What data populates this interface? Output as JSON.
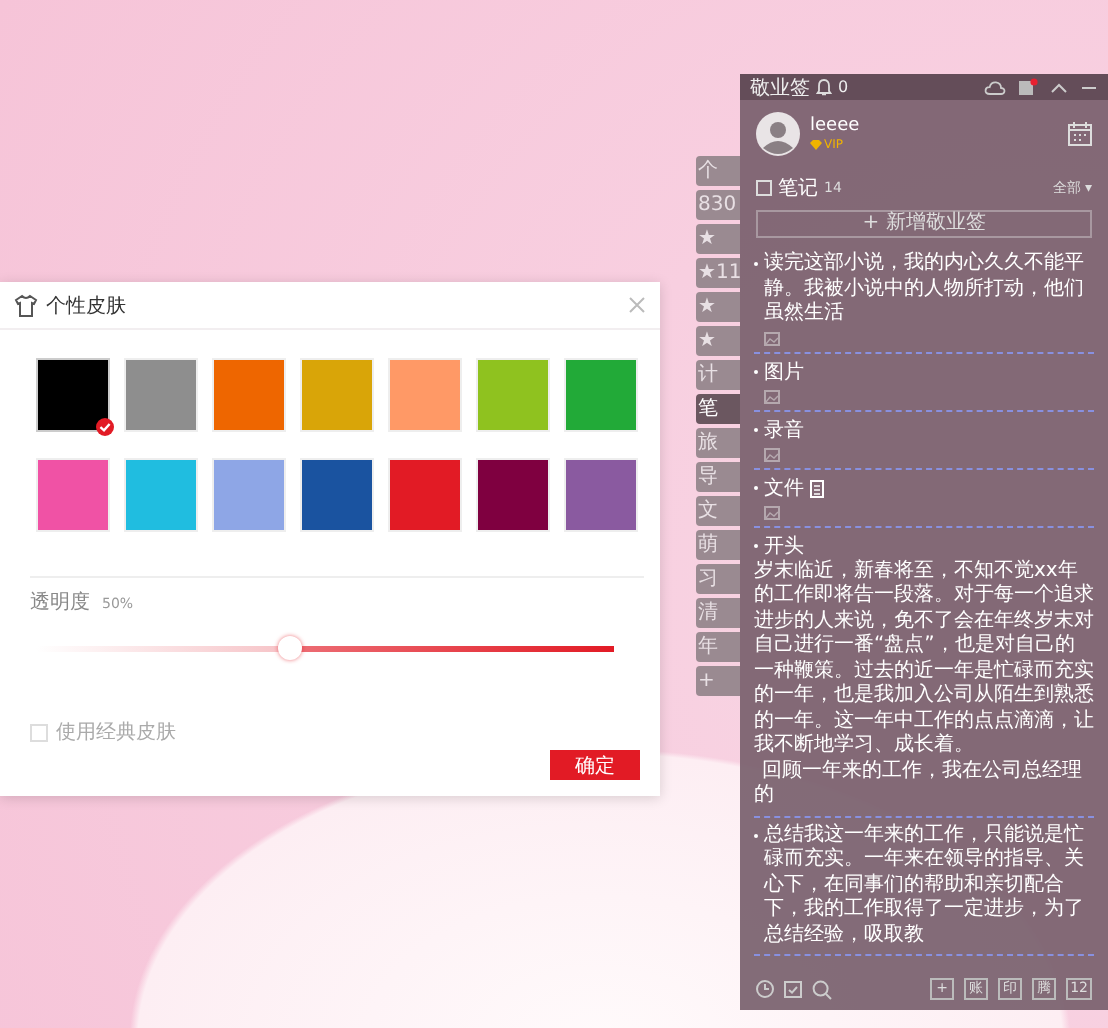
{
  "skin_dialog": {
    "title": "个性皮肤",
    "swatches": [
      {
        "color": "#000000",
        "selected": true
      },
      {
        "color": "#8e8e8e",
        "selected": false
      },
      {
        "color": "#ee6600",
        "selected": false
      },
      {
        "color": "#d9a508",
        "selected": false
      },
      {
        "color": "#ff9966",
        "selected": false
      },
      {
        "color": "#8fc21f",
        "selected": false
      },
      {
        "color": "#22aa38",
        "selected": false
      },
      {
        "color": "#f052a5",
        "selected": false
      },
      {
        "color": "#20bde0",
        "selected": false
      },
      {
        "color": "#8ea6e6",
        "selected": false
      },
      {
        "color": "#1a53a0",
        "selected": false
      },
      {
        "color": "#e21b25",
        "selected": false
      },
      {
        "color": "#7f0040",
        "selected": false
      },
      {
        "color": "#8a5aa0",
        "selected": false
      }
    ],
    "opacity": {
      "label": "透明度",
      "reading": "50%",
      "level": 0.44
    },
    "classic_skin": {
      "label": "使用经典皮肤",
      "checked": false
    },
    "confirm_button": "确定"
  },
  "side_tabs": [
    {
      "label": "个",
      "selected": false
    },
    {
      "label": "830",
      "selected": false
    },
    {
      "label": "★",
      "selected": false
    },
    {
      "label": "★11",
      "selected": false
    },
    {
      "label": "★",
      "selected": false
    },
    {
      "label": "★",
      "selected": false
    },
    {
      "label": "计",
      "selected": false
    },
    {
      "label": "笔",
      "selected": true
    },
    {
      "label": "旅",
      "selected": false
    },
    {
      "label": "导",
      "selected": false
    },
    {
      "label": "文",
      "selected": false
    },
    {
      "label": "萌",
      "selected": false
    },
    {
      "label": "习",
      "selected": false
    },
    {
      "label": "清",
      "selected": false
    },
    {
      "label": "年",
      "selected": false
    },
    {
      "label": "+",
      "selected": false
    }
  ],
  "notes_panel": {
    "title": "敬业签",
    "reminder_count": "0",
    "user": {
      "name": "leeee",
      "badge": "VIP"
    },
    "category": {
      "name": "笔记",
      "count": "14",
      "filter": "全部 ▾"
    },
    "add_button": "+ 新增敬业签",
    "notes": [
      {
        "body": "读完这部小说，我的内心久久不能平静。我被小说中的人物所打动，他们虽然生活",
        "attachment": true
      },
      {
        "title": "图片",
        "attachment": true,
        "file_icon": false
      },
      {
        "title": "录音",
        "attachment": true,
        "file_icon": false
      },
      {
        "title": "文件",
        "attachment": true,
        "file_icon": true
      },
      {
        "title": "开头",
        "body": "岁末临近，新春将至，不知不觉xx年的工作即将告一段落。对于每一个追求进步的人来说，免不了会在年终岁末对自己进行一番“盘点”，也是对自己的一种鞭策。过去的近一年是忙碌而充实的一年，也是我加入公司从陌生到熟悉的一年。这一年中工作的点点滴滴，让我不断地学习、成长着。",
        "continuation": "回顾一年来的工作，我在公司总经理的",
        "attachment": false,
        "file_icon": false
      },
      {
        "body": "总结我这一年来的工作，只能说是忙碌而充实。一年来在领导的指导、关心下，在同事们的帮助和亲切配合下，我的工作取得了一定进步，为了总结经验，吸取教",
        "attachment": false
      }
    ],
    "toolbar_keys": [
      "+",
      "账",
      "印",
      "腾",
      "12"
    ]
  }
}
